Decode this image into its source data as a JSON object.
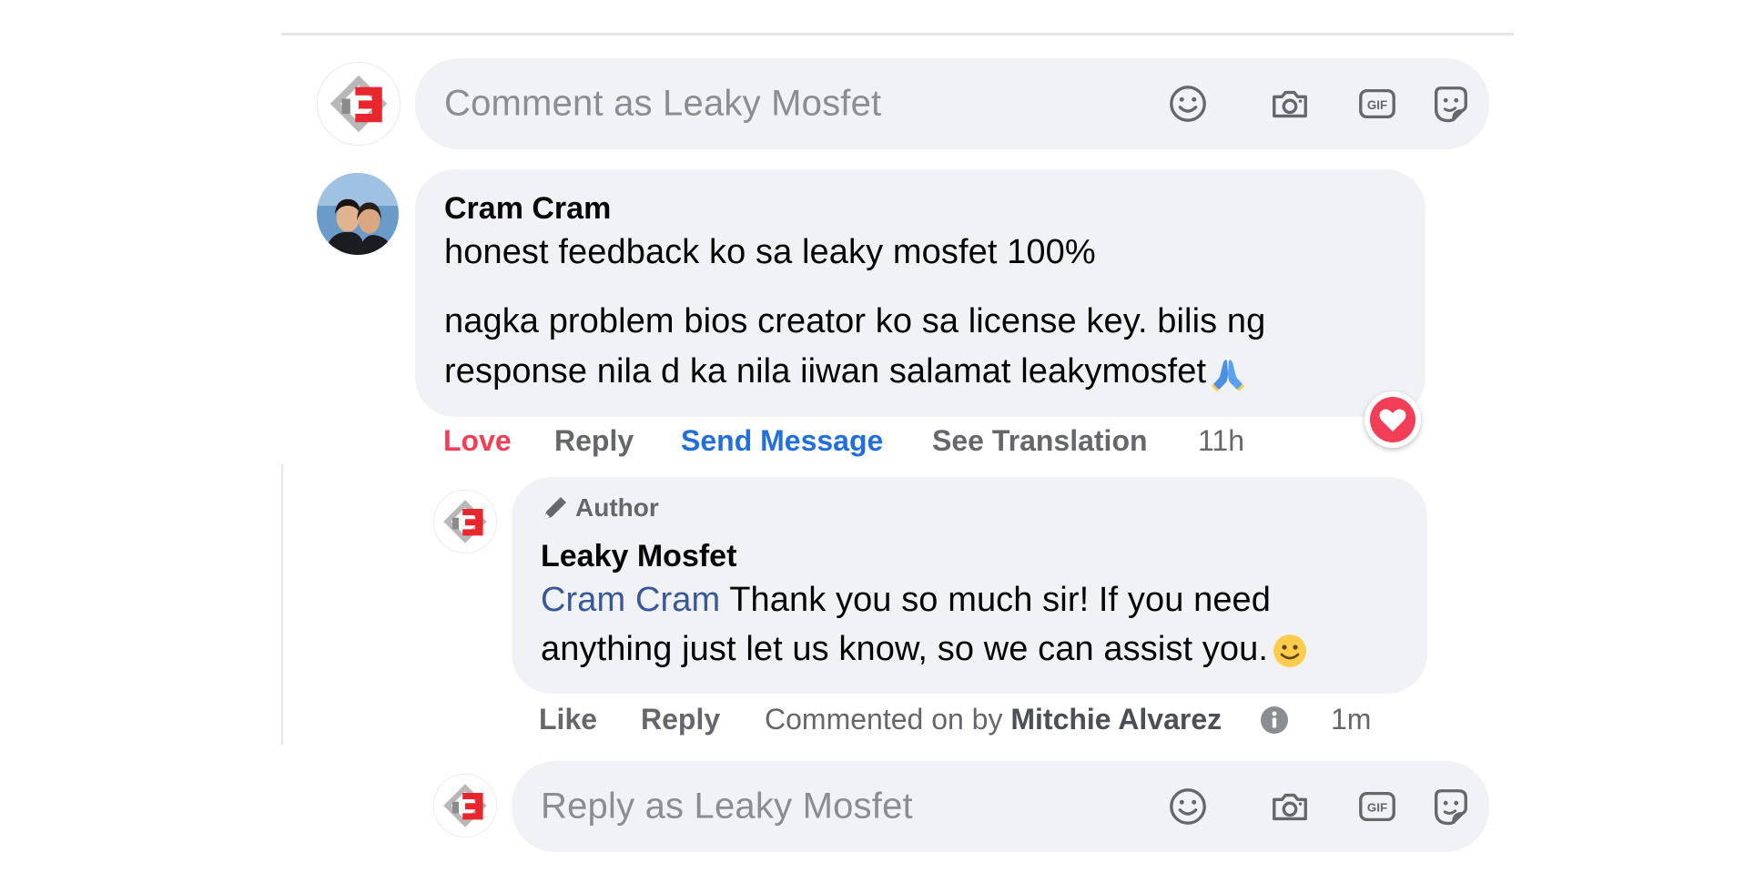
{
  "composer": {
    "placeholder": "Comment as Leaky Mosfet",
    "icons": [
      "emoji-icon",
      "camera-icon",
      "gif-icon",
      "sticker-icon"
    ]
  },
  "comment": {
    "author": "Cram Cram",
    "line1": "honest feedback ko sa leaky mosfet 100%",
    "line2": "nagka problem bios creator ko sa license key. bilis ng",
    "line3": "response nila d ka nila iiwan salamat leakymosfet",
    "reaction": "love",
    "actions": {
      "love": "Love",
      "reply": "Reply",
      "send_message": "Send Message",
      "see_translation": "See Translation",
      "time": "11h"
    }
  },
  "reply": {
    "badge": "Author",
    "author": "Leaky Mosfet",
    "mention": "Cram Cram",
    "line1_rest": " Thank you so much sir! If you need",
    "line2": "anything just let us know, so we can assist you.",
    "actions": {
      "like": "Like",
      "reply": "Reply",
      "commented_on_by": "Commented on by",
      "commenter": "Mitchie Alvarez",
      "time": "1m"
    }
  },
  "reply_composer": {
    "placeholder": "Reply as Leaky Mosfet"
  },
  "colors": {
    "love": "#f33e58",
    "link": "#216fdb",
    "mention": "#385898",
    "bubble": "#f0f2f5",
    "secondary_text": "#65676b"
  }
}
